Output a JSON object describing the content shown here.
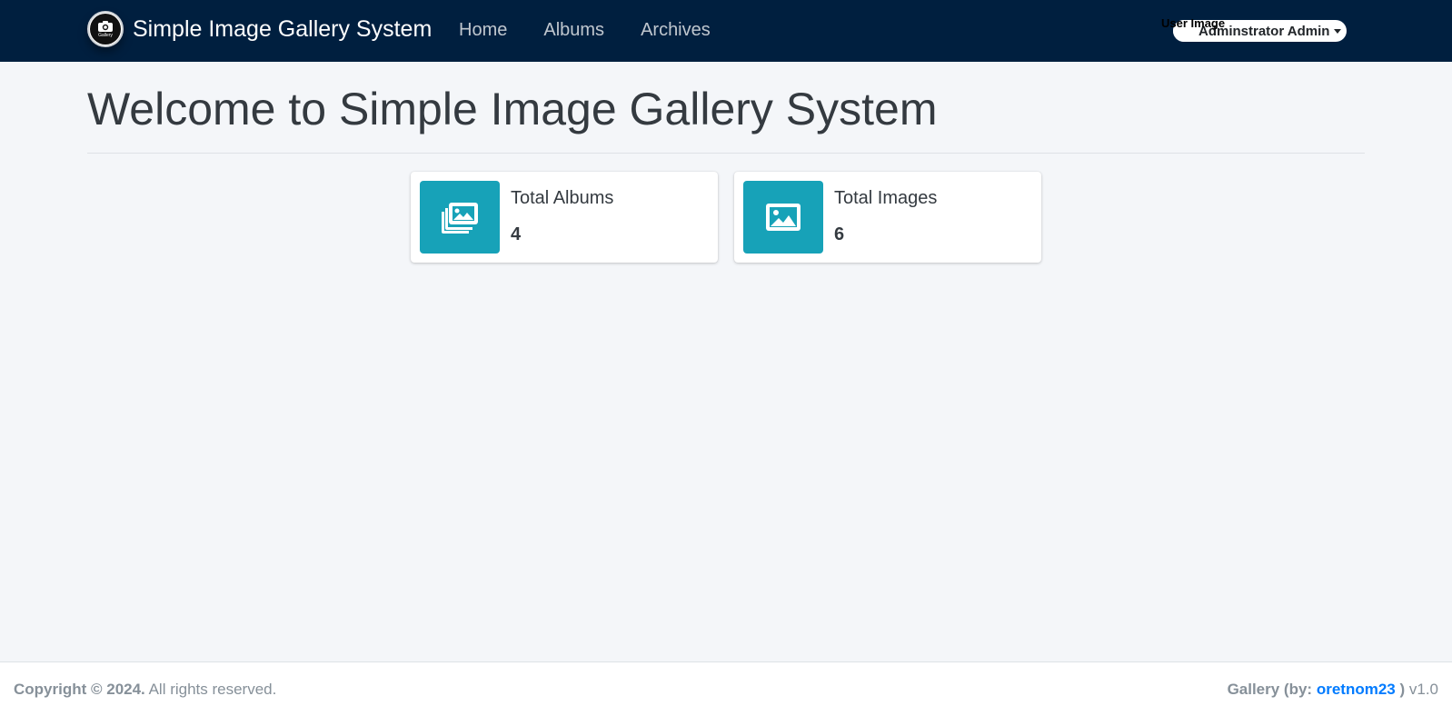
{
  "navbar": {
    "brand_title": "Simple Image Gallery System",
    "logo_text": "Gallery",
    "links": [
      {
        "label": "Home"
      },
      {
        "label": "Albums"
      },
      {
        "label": "Archives"
      }
    ],
    "user_image_alt": "User Image",
    "user_name": "Adminstrator Admin",
    "background_color": "#001f3f"
  },
  "main": {
    "title": "Welcome to Simple Image Gallery System",
    "info_boxes": [
      {
        "label": "Total Albums",
        "value": "4",
        "icon": "images-icon",
        "color": "#17a2b8"
      },
      {
        "label": "Total Images",
        "value": "6",
        "icon": "image-icon",
        "color": "#17a2b8"
      }
    ]
  },
  "footer": {
    "copyright_strong": "Copyright © 2024.",
    "rights": " All rights reserved.",
    "credit_prefix": "Gallery (by: ",
    "credit_author": "oretnom23",
    "credit_suffix": " )",
    "version": " v1.0"
  }
}
